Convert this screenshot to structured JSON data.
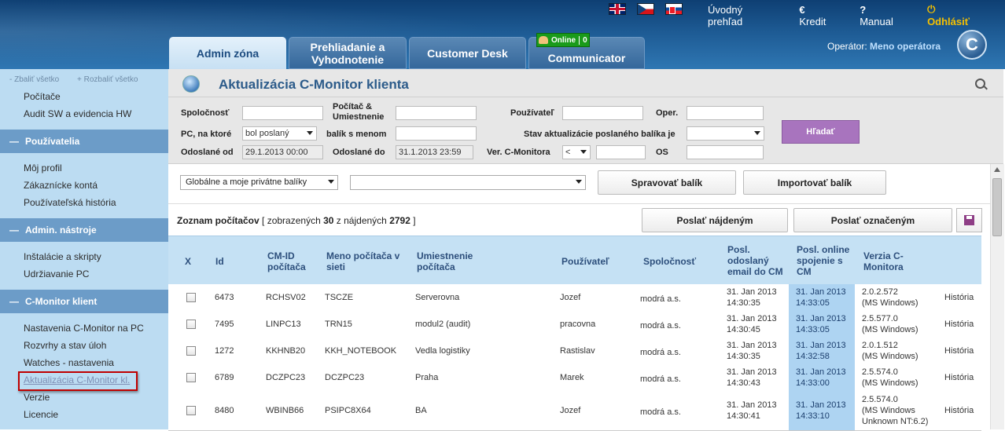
{
  "header": {
    "flags": [
      "uk-flag-icon",
      "cz-flag-icon",
      "sk-flag-icon"
    ],
    "links": {
      "overview": "Úvodný prehľad",
      "credit": "Kredit",
      "manual": "Manual",
      "logout": "Odhlásiť"
    },
    "tabs": {
      "admin": "Admin zóna",
      "prehl_line1": "Prehliadanie a",
      "prehl_line2": "Vyhodnotenie",
      "customer": "Customer Desk",
      "communicator": "Communicator"
    },
    "online_label": "Online",
    "online_count": "0",
    "operator_label": "Operátor:",
    "operator_name": "Meno operátora",
    "logo_letter": "C"
  },
  "sidebar": {
    "collapse_all": "- Zbaliť všetko",
    "expand_all": "+ Rozbaliť všetko",
    "links_top": [
      "Počítače",
      "Audit SW a evidencia HW"
    ],
    "section_users": "Používatelia",
    "users_links": [
      "Môj profil",
      "Zákaznícke kontá",
      "Používateľská história"
    ],
    "section_admin": "Admin. nástroje",
    "admin_links": [
      "Inštalácie a skripty",
      "Udržiavanie PC"
    ],
    "section_cmon": "C-Monitor klient",
    "cmon_links": [
      "Nastavenia C-Monitor na PC",
      "Rozvrhy a stav úloh",
      "Watches - nastavenia"
    ],
    "active_link": "Aktualizácia C-Monitor kl.",
    "cmon_links_after": [
      "Verzie",
      "Licencie"
    ]
  },
  "page": {
    "title": "Aktualizácia C-Monitor klienta"
  },
  "filter": {
    "company_label": "Spoločnosť",
    "computer_label_1": "Počítač &",
    "computer_label_2": "Umiestnenie",
    "user_label": "Používateľ",
    "oper_label": "Oper.",
    "pc_label": "PC, na ktoré",
    "pc_select": "bol poslaný",
    "package_label": "balík s menom",
    "state_label": "Stav aktualizácie poslaného balíka je",
    "sent_from_label": "Odoslané od",
    "sent_from_value": "29.1.2013 00:00",
    "sent_to_label": "Odoslané do",
    "sent_to_value": "31.1.2013 23:59",
    "ver_label": "Ver. C-Monitora",
    "ver_op": "<",
    "os_label": "OS",
    "search_button": "Hľadať"
  },
  "toolbar": {
    "packages_select": "Globálne a moje privátne balíky",
    "manage_button": "Spravovať balík",
    "import_button": "Importovať balík",
    "send_found_button": "Poslať nájdeným",
    "send_marked_button": "Poslať označeným"
  },
  "list": {
    "title": "Zoznam počítačov",
    "summary_pre": "[ zobrazených",
    "shown": "30",
    "summary_mid": "z nájdených",
    "found": "2792",
    "summary_post": "]"
  },
  "columns": {
    "x": "X",
    "id": "Id",
    "cmid_1": "CM-ID",
    "cmid_2": "počítača",
    "name_1": "Meno počítača v",
    "name_2": "sieti",
    "loc_1": "Umiestnenie",
    "loc_2": "počítača",
    "user": "Používateľ",
    "company": "Spoločnosť",
    "email_1": "Posl.",
    "email_2": "odoslaný",
    "email_3": "email do CM",
    "online_1": "Posl. online",
    "online_2": "spojenie s",
    "online_3": "CM",
    "ver_1": "Verzia C-",
    "ver_2": "Monitora"
  },
  "rows": [
    {
      "id": "6473",
      "cmid": "RCHSV02",
      "name": "TSCZE",
      "location": "Serverovna",
      "user": "Jozef",
      "company": "modrá a.s.",
      "email_date": "31. Jan 2013",
      "email_time": "14:30:35",
      "online_date": "31. Jan 2013",
      "online_time": "14:33:05",
      "ver": "2.0.2.572",
      "ver_os": "(MS Windows)",
      "ver_os2": "",
      "history": "História"
    },
    {
      "id": "7495",
      "cmid": "LINPC13",
      "name": "TRN15",
      "location": "modul2 (audit)",
      "user": "pracovna",
      "company": "modrá a.s.",
      "email_date": "31. Jan 2013",
      "email_time": "14:30:45",
      "online_date": "31. Jan 2013",
      "online_time": "14:33:05",
      "ver": "2.5.577.0",
      "ver_os": "(MS Windows)",
      "ver_os2": "",
      "history": "História"
    },
    {
      "id": "1272",
      "cmid": "KKHNB20",
      "name": "KKH_NOTEBOOK",
      "location": "Vedla logistiky",
      "user": "Rastislav",
      "company": "modrá a.s.",
      "email_date": "31. Jan 2013",
      "email_time": "14:30:35",
      "online_date": "31. Jan 2013",
      "online_time": "14:32:58",
      "ver": "2.0.1.512",
      "ver_os": "(MS Windows)",
      "ver_os2": "",
      "history": "História"
    },
    {
      "id": "6789",
      "cmid": "DCZPC23",
      "name": "DCZPC23",
      "location": "Praha",
      "user": "Marek",
      "company": "modrá a.s.",
      "email_date": "31. Jan 2013",
      "email_time": "14:30:43",
      "online_date": "31. Jan 2013",
      "online_time": "14:33:00",
      "ver": "2.5.574.0",
      "ver_os": "(MS Windows)",
      "ver_os2": "",
      "history": "História"
    },
    {
      "id": "8480",
      "cmid": "WBINB66",
      "name": "PSIPC8X64",
      "location": "BA",
      "user": "Jozef",
      "company": "modrá a.s.",
      "email_date": "31. Jan 2013",
      "email_time": "14:30:41",
      "online_date": "31. Jan 2013",
      "online_time": "14:33:10",
      "ver": "2.5.574.0",
      "ver_os": "(MS Windows",
      "ver_os2": "Unknown NT:6.2)",
      "history": "História"
    }
  ]
}
